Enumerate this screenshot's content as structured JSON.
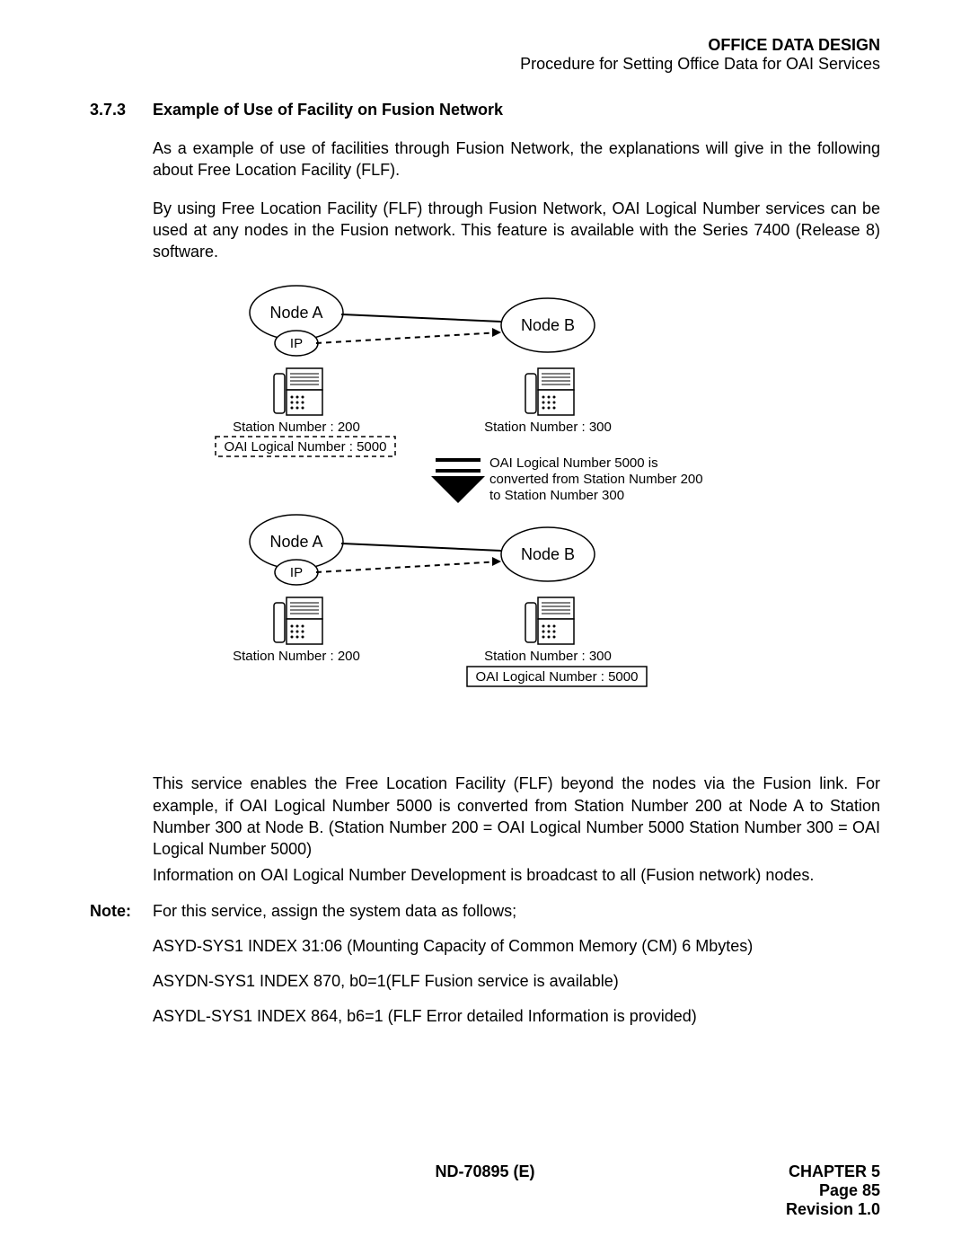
{
  "header": {
    "title": "OFFICE DATA DESIGN",
    "subtitle": "Procedure for Setting Office Data for OAI Services"
  },
  "section": {
    "number": "3.7.3",
    "title": "Example of Use of Facility on Fusion Network"
  },
  "para1": "As a example of use of facilities through Fusion Network, the explanations will give in the following about Free Location Facility (FLF).",
  "para2": "By using Free Location Facility (FLF) through Fusion Network, OAI Logical Number services can be used at any nodes in the Fusion network. This feature is available with the Series 7400 (Release 8) software.",
  "diagram": {
    "top": {
      "nodeA": "Node A",
      "ip": "IP",
      "nodeB": "Node B",
      "stationA": "Station Number : 200",
      "oaiA": "OAI Logical Number : 5000",
      "stationB": "Station Number : 300",
      "convert1": "OAI Logical Number 5000 is",
      "convert2": "converted from Station Number 200",
      "convert3": "to Station Number 300"
    },
    "bottom": {
      "nodeA": "Node A",
      "ip": "IP",
      "nodeB": "Node B",
      "stationA": "Station Number : 200",
      "stationB": "Station Number : 300",
      "oaiB": "OAI Logical Number : 5000"
    }
  },
  "para3": "This service enables the Free Location Facility (FLF) beyond the nodes via the Fusion link. For example, if OAI Logical Number 5000 is converted from Station Number 200 at Node A to Station Number 300 at Node B. (Station Number 200 = OAI Logical Number 5000 Station Number 300 = OAI Logical Number 5000)",
  "para4": "Information on OAI Logical Number Development is broadcast to all (Fusion network) nodes.",
  "note": {
    "label": "Note:",
    "text": "For this service, assign the system data as follows;"
  },
  "data1": "ASYD-SYS1 INDEX 31:06 (Mounting Capacity of Common Memory (CM) 6 Mbytes)",
  "data2": "ASYDN-SYS1 INDEX 870, b0=1(FLF Fusion service is available)",
  "data3": "ASYDL-SYS1 INDEX 864, b6=1 (FLF Error detailed Information is provided)",
  "footer": {
    "docnum": "ND-70895 (E)",
    "chapter": "CHAPTER 5",
    "page": "Page 85",
    "revision": "Revision 1.0"
  }
}
